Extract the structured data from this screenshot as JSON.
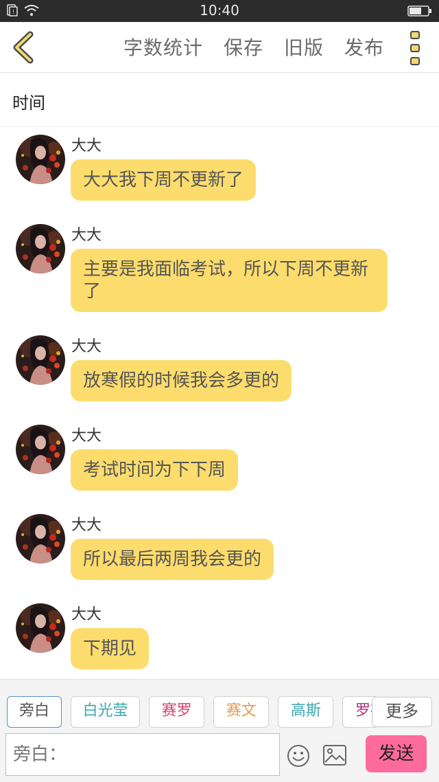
{
  "status_bar": {
    "time": "10:40",
    "icons": [
      "sim-icon",
      "wifi-icon",
      "battery-icon"
    ]
  },
  "nav": {
    "actions": [
      "字数统计",
      "保存",
      "旧版",
      "发布"
    ],
    "back_icon": "back-chevron-icon",
    "more_icon": "more-vertical-icon"
  },
  "title": "时间",
  "colors": {
    "bubble": "#fcdc6c",
    "send": "#ff6a9c",
    "active_chip_border": "#5a8cc7"
  },
  "messages": [
    {
      "sender": "大大",
      "text": "大大我下周不更新了"
    },
    {
      "sender": "大大",
      "text": "主要是我面临考试，所以下周不更新了"
    },
    {
      "sender": "大大",
      "text": "放寒假的时候我会多更的"
    },
    {
      "sender": "大大",
      "text": "考试时间为下下周"
    },
    {
      "sender": "大大",
      "text": "所以最后两周我会更的"
    },
    {
      "sender": "大大",
      "text": "下期见"
    }
  ],
  "characters": [
    {
      "name": "旁白",
      "color": "#555555",
      "active": true
    },
    {
      "name": "白光莹",
      "color": "#3aa6ad"
    },
    {
      "name": "赛罗",
      "color": "#d2436f"
    },
    {
      "name": "赛文",
      "color": "#e89a4c"
    },
    {
      "name": "高斯",
      "color": "#3aa6ad"
    },
    {
      "name": "罗布",
      "color": "#b0307f"
    }
  ],
  "more_label": "更多",
  "input": {
    "placeholder": "旁白："
  },
  "send_label": "发送"
}
